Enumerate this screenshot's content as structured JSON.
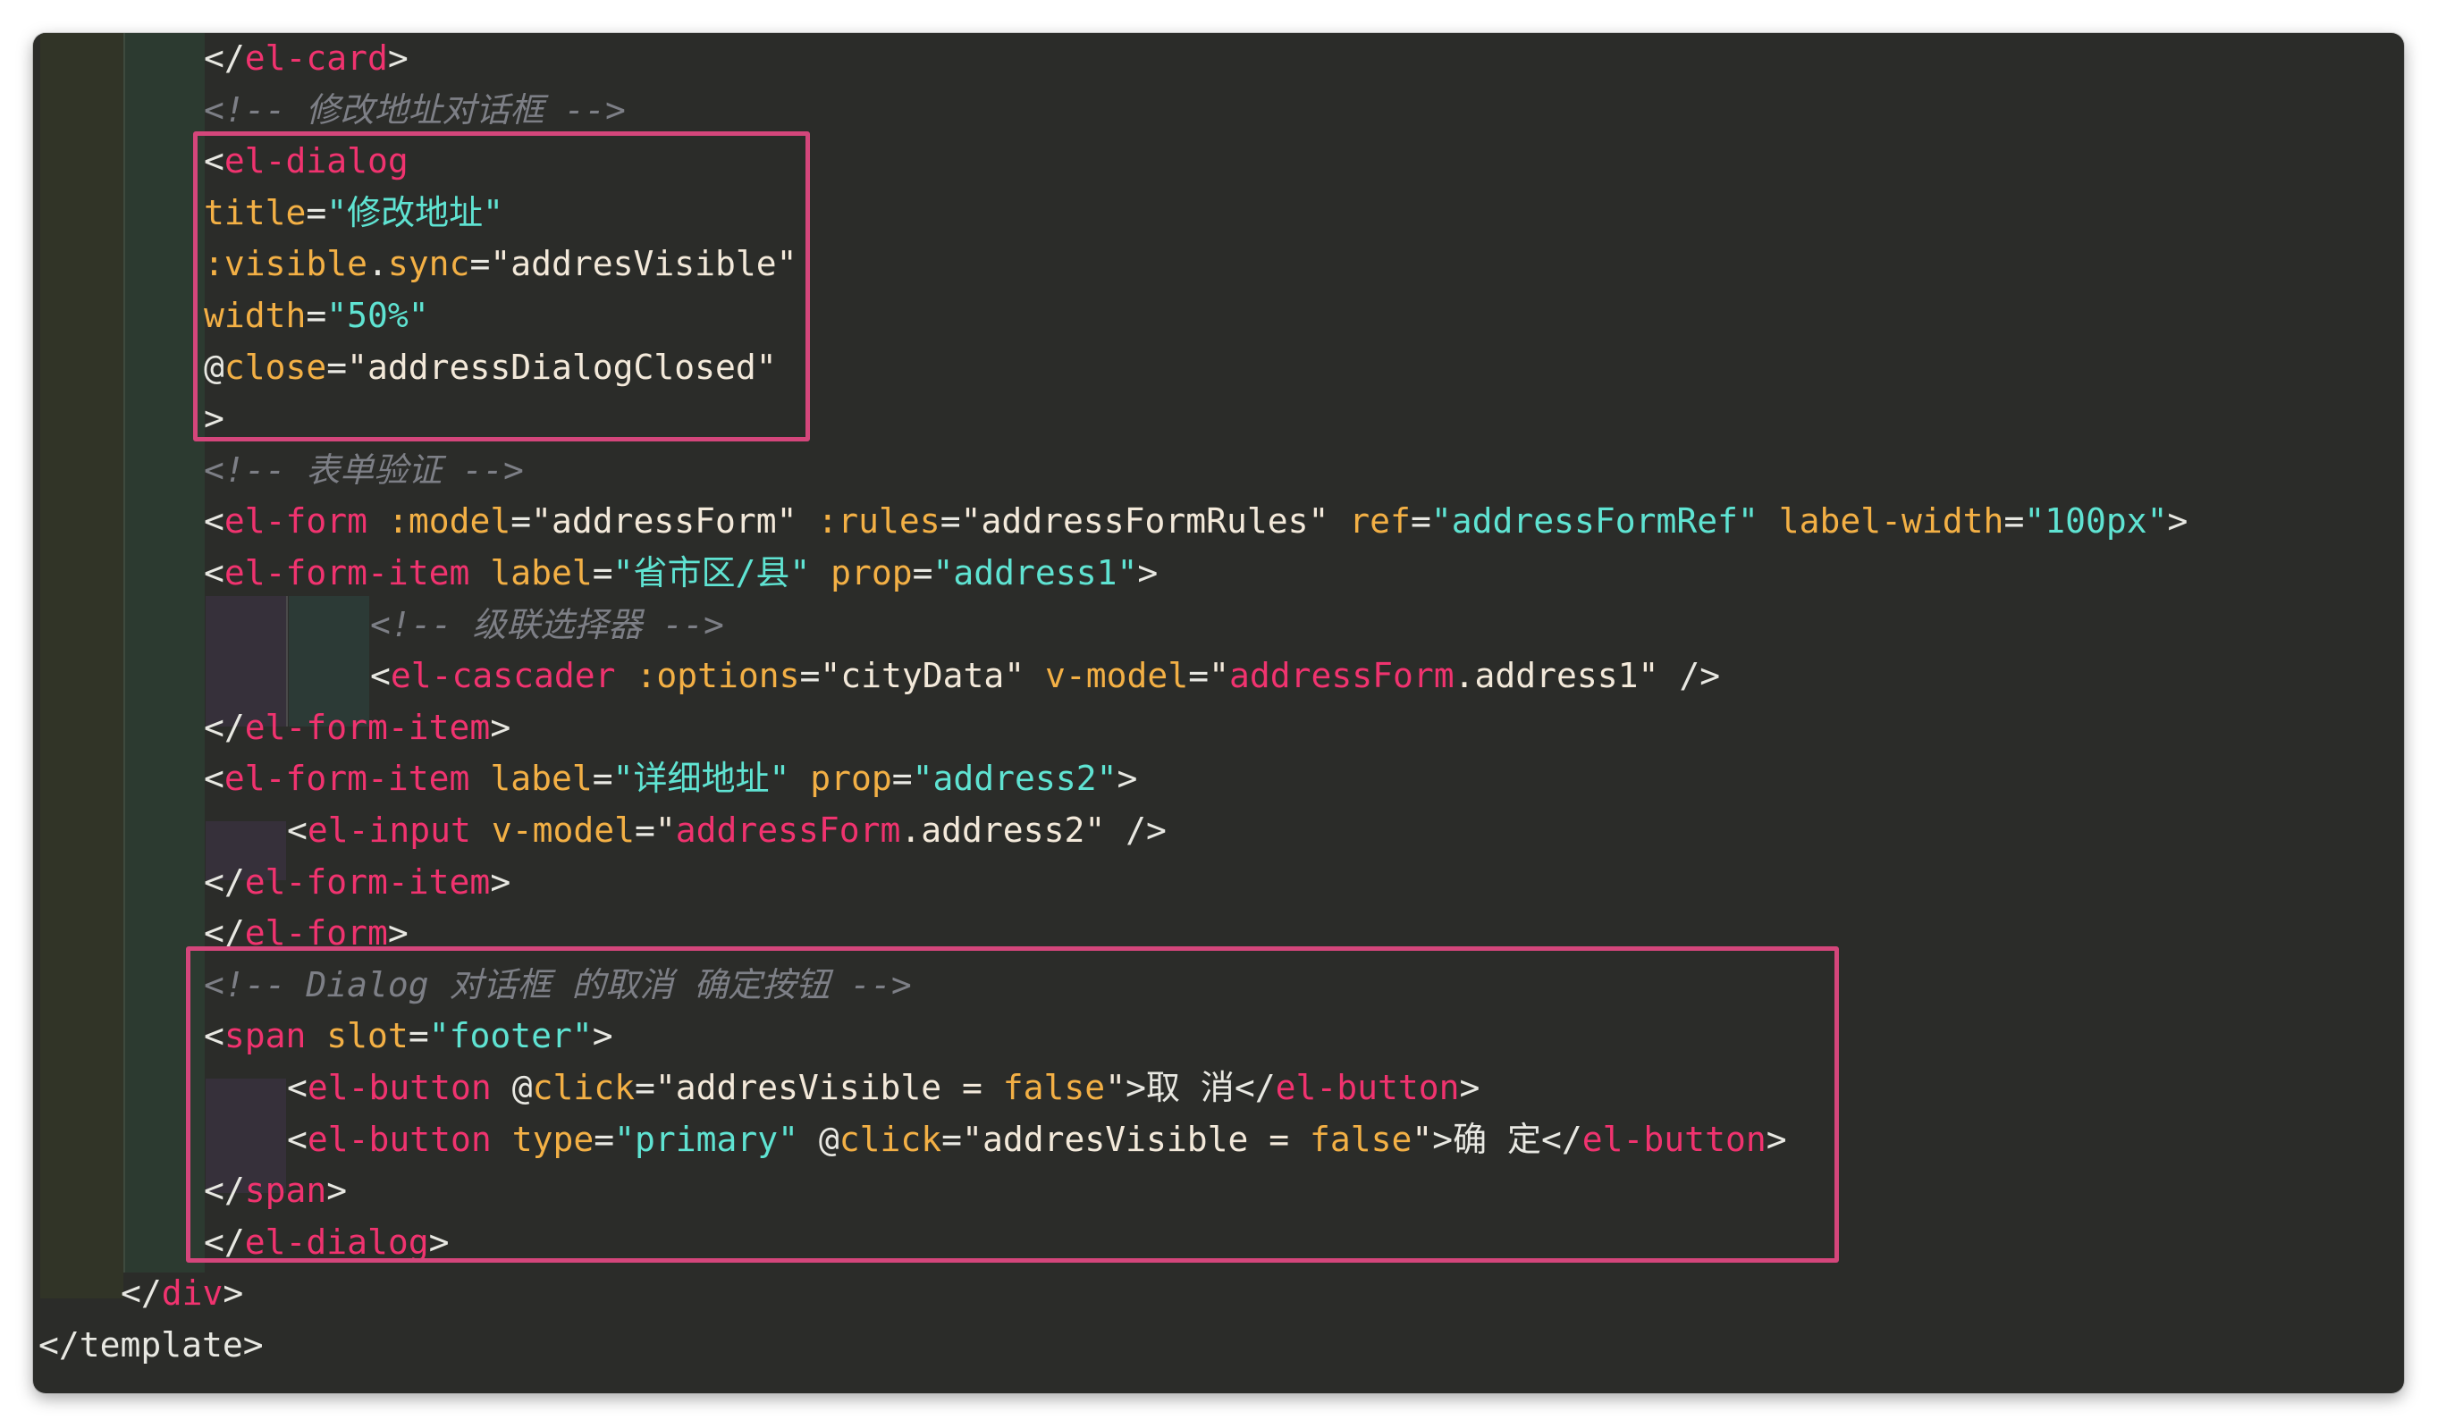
{
  "editor": {
    "language": "vue-template",
    "lines": [
      {
        "indent": 191,
        "tokens": [
          {
            "t": "</",
            "c": "t-punct"
          },
          {
            "t": "el-card",
            "c": "t-tag"
          },
          {
            "t": ">",
            "c": "t-punct"
          }
        ]
      },
      {
        "indent": 191,
        "tokens": [
          {
            "t": "<!-- 修改地址对话框 -->",
            "c": "t-cmt"
          }
        ]
      },
      {
        "indent": 191,
        "tokens": [
          {
            "t": "<",
            "c": "t-punct"
          },
          {
            "t": "el-dialog",
            "c": "t-tag"
          }
        ]
      },
      {
        "indent": 191,
        "tokens": [
          {
            "t": "title",
            "c": "t-attr"
          },
          {
            "t": "=",
            "c": "t-punct"
          },
          {
            "t": "\"修改地址\"",
            "c": "t-str"
          }
        ]
      },
      {
        "indent": 191,
        "tokens": [
          {
            "t": ":visible",
            "c": "t-attr"
          },
          {
            "t": ".",
            "c": "t-punct"
          },
          {
            "t": "sync",
            "c": "t-attr"
          },
          {
            "t": "=",
            "c": "t-punct"
          },
          {
            "t": "\"addresVisible\"",
            "c": "t-val"
          }
        ]
      },
      {
        "indent": 191,
        "tokens": [
          {
            "t": "width",
            "c": "t-attr"
          },
          {
            "t": "=",
            "c": "t-punct"
          },
          {
            "t": "\"50%\"",
            "c": "t-str"
          }
        ]
      },
      {
        "indent": 191,
        "tokens": [
          {
            "t": "@",
            "c": "t-punct"
          },
          {
            "t": "close",
            "c": "t-attr"
          },
          {
            "t": "=",
            "c": "t-punct"
          },
          {
            "t": "\"addressDialogClosed\"",
            "c": "t-val"
          }
        ]
      },
      {
        "indent": 191,
        "tokens": [
          {
            "t": ">",
            "c": "t-punct"
          }
        ]
      },
      {
        "indent": 191,
        "tokens": [
          {
            "t": "<!-- 表单验证 -->",
            "c": "t-cmt"
          }
        ]
      },
      {
        "indent": 191,
        "tokens": [
          {
            "t": "<",
            "c": "t-punct"
          },
          {
            "t": "el-form",
            "c": "t-tag"
          },
          {
            "t": " ",
            "c": "t-punct"
          },
          {
            "t": ":model",
            "c": "t-attr"
          },
          {
            "t": "=",
            "c": "t-punct"
          },
          {
            "t": "\"addressForm\"",
            "c": "t-val"
          },
          {
            "t": " ",
            "c": "t-punct"
          },
          {
            "t": ":rules",
            "c": "t-attr"
          },
          {
            "t": "=",
            "c": "t-punct"
          },
          {
            "t": "\"addressFormRules\"",
            "c": "t-val"
          },
          {
            "t": " ",
            "c": "t-punct"
          },
          {
            "t": "ref",
            "c": "t-attr"
          },
          {
            "t": "=",
            "c": "t-punct"
          },
          {
            "t": "\"addressFormRef\"",
            "c": "t-str"
          },
          {
            "t": " ",
            "c": "t-punct"
          },
          {
            "t": "label-width",
            "c": "t-attr"
          },
          {
            "t": "=",
            "c": "t-punct"
          },
          {
            "t": "\"100px\"",
            "c": "t-str"
          },
          {
            "t": ">",
            "c": "t-punct"
          }
        ]
      },
      {
        "indent": 191,
        "tokens": [
          {
            "t": "<",
            "c": "t-punct"
          },
          {
            "t": "el-form-item",
            "c": "t-tag"
          },
          {
            "t": " ",
            "c": "t-punct"
          },
          {
            "t": "label",
            "c": "t-attr"
          },
          {
            "t": "=",
            "c": "t-punct"
          },
          {
            "t": "\"省市区/县\"",
            "c": "t-str"
          },
          {
            "t": " ",
            "c": "t-punct"
          },
          {
            "t": "prop",
            "c": "t-attr"
          },
          {
            "t": "=",
            "c": "t-punct"
          },
          {
            "t": "\"address1\"",
            "c": "t-str"
          },
          {
            "t": ">",
            "c": "t-punct"
          }
        ]
      },
      {
        "indent": 377,
        "tokens": [
          {
            "t": "<!-- 级联选择器 -->",
            "c": "t-cmt"
          }
        ]
      },
      {
        "indent": 377,
        "tokens": [
          {
            "t": "<",
            "c": "t-punct"
          },
          {
            "t": "el-cascader",
            "c": "t-tag"
          },
          {
            "t": " ",
            "c": "t-punct"
          },
          {
            "t": ":options",
            "c": "t-attr"
          },
          {
            "t": "=",
            "c": "t-punct"
          },
          {
            "t": "\"cityData\"",
            "c": "t-val"
          },
          {
            "t": " ",
            "c": "t-punct"
          },
          {
            "t": "v-model",
            "c": "t-attr"
          },
          {
            "t": "=",
            "c": "t-punct"
          },
          {
            "t": "\"",
            "c": "t-val"
          },
          {
            "t": "addressForm",
            "c": "t-model"
          },
          {
            "t": ".address1\"",
            "c": "t-val"
          },
          {
            "t": " />",
            "c": "t-punct"
          }
        ]
      },
      {
        "indent": 191,
        "tokens": [
          {
            "t": "</",
            "c": "t-punct"
          },
          {
            "t": "el-form-item",
            "c": "t-tag"
          },
          {
            "t": ">",
            "c": "t-punct"
          }
        ]
      },
      {
        "indent": 191,
        "tokens": [
          {
            "t": "<",
            "c": "t-punct"
          },
          {
            "t": "el-form-item",
            "c": "t-tag"
          },
          {
            "t": " ",
            "c": "t-punct"
          },
          {
            "t": "label",
            "c": "t-attr"
          },
          {
            "t": "=",
            "c": "t-punct"
          },
          {
            "t": "\"详细地址\"",
            "c": "t-str"
          },
          {
            "t": " ",
            "c": "t-punct"
          },
          {
            "t": "prop",
            "c": "t-attr"
          },
          {
            "t": "=",
            "c": "t-punct"
          },
          {
            "t": "\"address2\"",
            "c": "t-str"
          },
          {
            "t": ">",
            "c": "t-punct"
          }
        ]
      },
      {
        "indent": 284,
        "tokens": [
          {
            "t": "<",
            "c": "t-punct"
          },
          {
            "t": "el-input",
            "c": "t-tag"
          },
          {
            "t": " ",
            "c": "t-punct"
          },
          {
            "t": "v-model",
            "c": "t-attr"
          },
          {
            "t": "=",
            "c": "t-punct"
          },
          {
            "t": "\"",
            "c": "t-val"
          },
          {
            "t": "addressForm",
            "c": "t-model"
          },
          {
            "t": ".address2\"",
            "c": "t-val"
          },
          {
            "t": " />",
            "c": "t-punct"
          }
        ]
      },
      {
        "indent": 191,
        "tokens": [
          {
            "t": "</",
            "c": "t-punct"
          },
          {
            "t": "el-form-item",
            "c": "t-tag"
          },
          {
            "t": ">",
            "c": "t-punct"
          }
        ]
      },
      {
        "indent": 191,
        "tokens": [
          {
            "t": "</",
            "c": "t-punct"
          },
          {
            "t": "el-form",
            "c": "t-tag"
          },
          {
            "t": ">",
            "c": "t-punct"
          }
        ]
      },
      {
        "indent": 191,
        "tokens": [
          {
            "t": "<!-- Dialog 对话框 的取消 确定按钮 -->",
            "c": "t-cmt"
          }
        ]
      },
      {
        "indent": 191,
        "tokens": [
          {
            "t": "<",
            "c": "t-punct"
          },
          {
            "t": "span",
            "c": "t-tag"
          },
          {
            "t": " ",
            "c": "t-punct"
          },
          {
            "t": "slot",
            "c": "t-attr"
          },
          {
            "t": "=",
            "c": "t-punct"
          },
          {
            "t": "\"footer\"",
            "c": "t-str"
          },
          {
            "t": ">",
            "c": "t-punct"
          }
        ]
      },
      {
        "indent": 284,
        "tokens": [
          {
            "t": "<",
            "c": "t-punct"
          },
          {
            "t": "el-button",
            "c": "t-tag"
          },
          {
            "t": " ",
            "c": "t-punct"
          },
          {
            "t": "@",
            "c": "t-punct"
          },
          {
            "t": "click",
            "c": "t-attr"
          },
          {
            "t": "=",
            "c": "t-punct"
          },
          {
            "t": "\"addresVisible = ",
            "c": "t-val"
          },
          {
            "t": "false",
            "c": "t-kw"
          },
          {
            "t": "\"",
            "c": "t-val"
          },
          {
            "t": ">取 消</",
            "c": "t-punct"
          },
          {
            "t": "el-button",
            "c": "t-tag"
          },
          {
            "t": ">",
            "c": "t-punct"
          }
        ]
      },
      {
        "indent": 284,
        "tokens": [
          {
            "t": "<",
            "c": "t-punct"
          },
          {
            "t": "el-button",
            "c": "t-tag"
          },
          {
            "t": " ",
            "c": "t-punct"
          },
          {
            "t": "type",
            "c": "t-attr"
          },
          {
            "t": "=",
            "c": "t-punct"
          },
          {
            "t": "\"primary\"",
            "c": "t-str"
          },
          {
            "t": " ",
            "c": "t-punct"
          },
          {
            "t": "@",
            "c": "t-punct"
          },
          {
            "t": "click",
            "c": "t-attr"
          },
          {
            "t": "=",
            "c": "t-punct"
          },
          {
            "t": "\"addresVisible = ",
            "c": "t-val"
          },
          {
            "t": "false",
            "c": "t-kw"
          },
          {
            "t": "\"",
            "c": "t-val"
          },
          {
            "t": ">确 定</",
            "c": "t-punct"
          },
          {
            "t": "el-button",
            "c": "t-tag"
          },
          {
            "t": ">",
            "c": "t-punct"
          }
        ]
      },
      {
        "indent": 191,
        "tokens": [
          {
            "t": "</",
            "c": "t-punct"
          },
          {
            "t": "span",
            "c": "t-tag"
          },
          {
            "t": ">",
            "c": "t-punct"
          }
        ]
      },
      {
        "indent": 191,
        "tokens": [
          {
            "t": "</",
            "c": "t-punct"
          },
          {
            "t": "el-dialog",
            "c": "t-tag"
          },
          {
            "t": ">",
            "c": "t-punct"
          }
        ]
      },
      {
        "indent": 98,
        "tokens": [
          {
            "t": "</",
            "c": "t-punct"
          },
          {
            "t": "div",
            "c": "t-tag"
          },
          {
            "t": ">",
            "c": "t-punct"
          }
        ]
      },
      {
        "indent": 6,
        "tokens": [
          {
            "t": "</template>",
            "c": "t-punct"
          }
        ]
      }
    ]
  },
  "colors": {
    "background": "#2b2c29",
    "highlight_border": "#d4467b",
    "tag": "#f0336f",
    "attribute": "#f3b045",
    "string": "#5fe3d2",
    "comment": "#7d7f86"
  }
}
